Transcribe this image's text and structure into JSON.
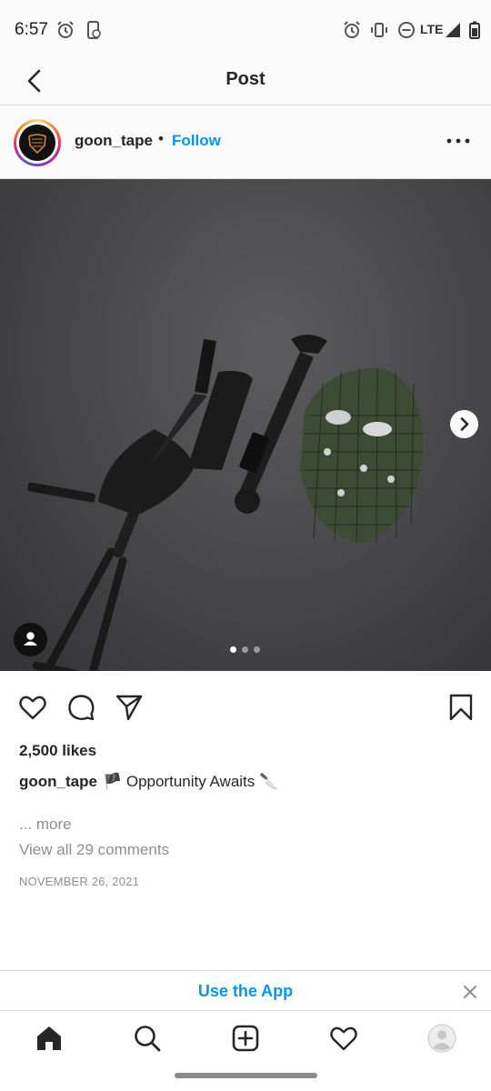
{
  "status_bar": {
    "time": "6:57",
    "network": "LTE",
    "icons": [
      "alarm-icon",
      "screen-share-icon",
      "alarm-icon",
      "vibrate-icon",
      "do-not-disturb-icon",
      "signal-icon",
      "battery-icon"
    ]
  },
  "topbar": {
    "title": "Post"
  },
  "post": {
    "username": "goon_tape",
    "separator": "•",
    "follow_label": "Follow",
    "image_description_items": [
      "shovel-icon",
      "knife-icon",
      "wrench-icon",
      "hockey-mask-icon"
    ],
    "carousel": {
      "count": 3,
      "active_index": 0
    },
    "likes": "2,500 likes",
    "caption_user": "goon_tape",
    "caption_text": "🏴 Opportunity Awaits 🔪",
    "more_label": "... more",
    "view_comments": "View all 29 comments",
    "date": "NOVEMBER 26, 2021"
  },
  "app_banner": {
    "label": "Use the App"
  },
  "colors": {
    "accent": "#0095f6",
    "text": "#262626",
    "muted": "#8e8e8e",
    "divider": "#dbdbdb"
  }
}
